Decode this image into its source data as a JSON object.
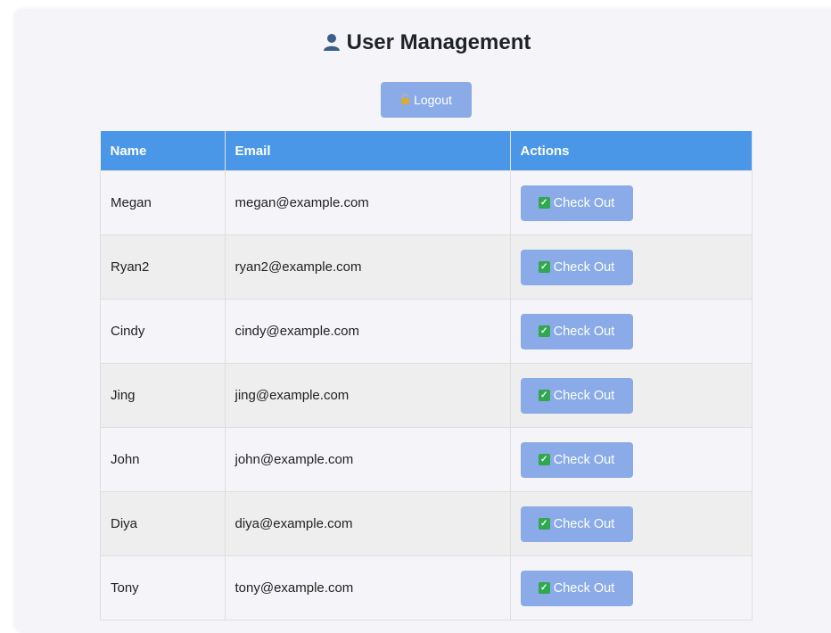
{
  "page": {
    "title": "User Management",
    "title_icon": "user-silhouette-icon",
    "logout_label": "Logout",
    "logout_icon": "padlock-icon"
  },
  "table": {
    "headers": [
      "Name",
      "Email",
      "Actions"
    ],
    "action_label": "Check Out",
    "action_icon": "checkmark-box-icon",
    "rows": [
      {
        "name": "Megan",
        "email": "megan@example.com"
      },
      {
        "name": "Ryan2",
        "email": "ryan2@example.com"
      },
      {
        "name": "Cindy",
        "email": "cindy@example.com"
      },
      {
        "name": "Jing",
        "email": "jing@example.com"
      },
      {
        "name": "John",
        "email": "john@example.com"
      },
      {
        "name": "Diya",
        "email": "diya@example.com"
      },
      {
        "name": "Tony",
        "email": "tony@example.com"
      }
    ]
  },
  "colors": {
    "header_bg": "#4a97e8",
    "button_bg": "#8aabe8",
    "check_icon": "#2fa84f"
  }
}
